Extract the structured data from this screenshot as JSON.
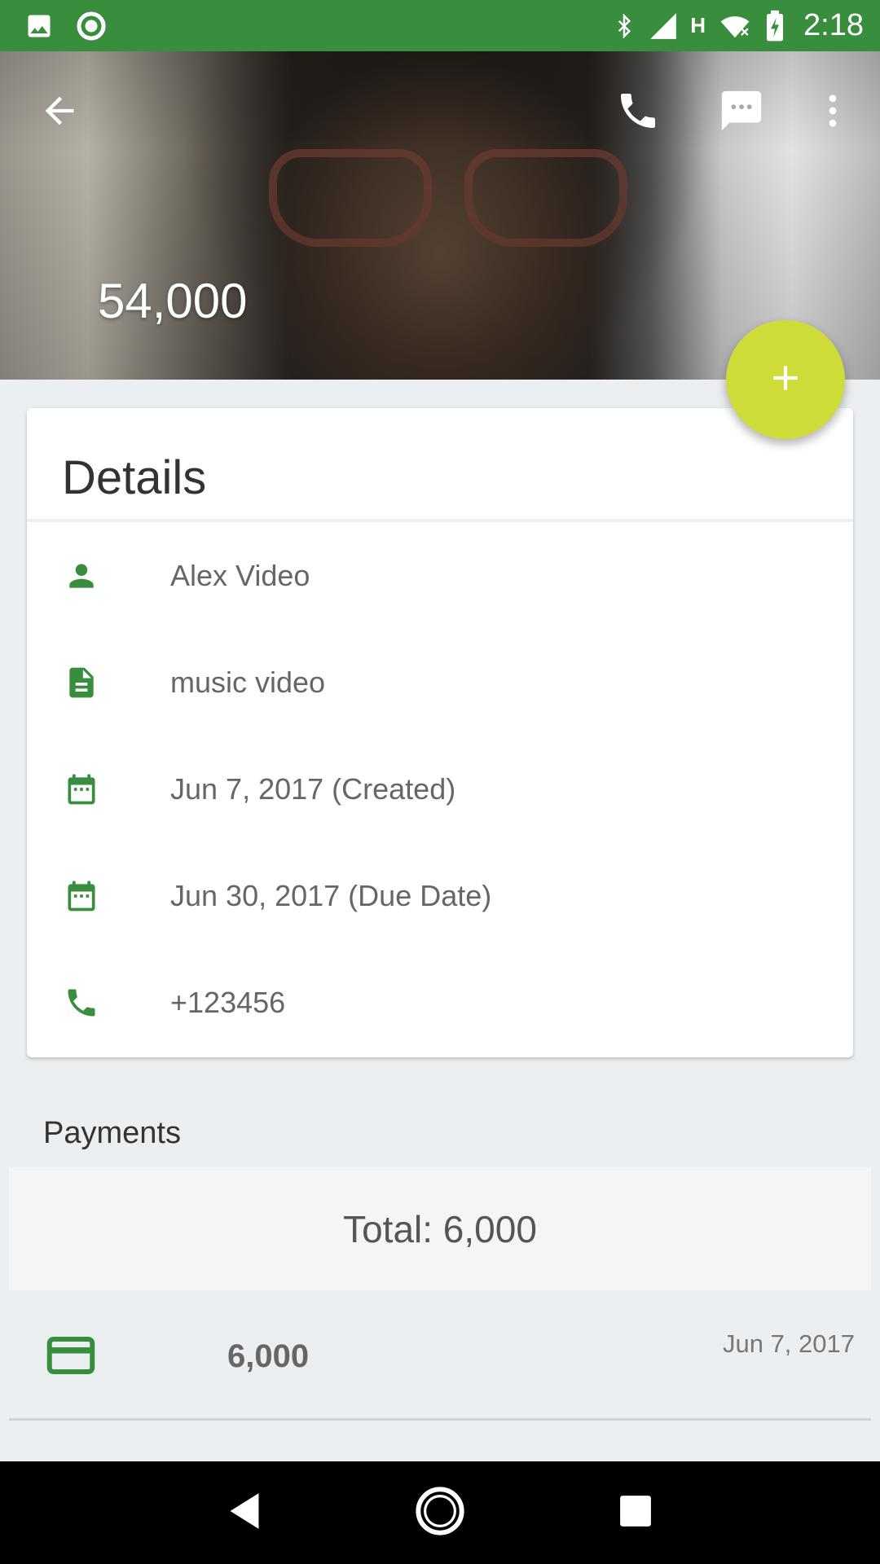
{
  "status_bar": {
    "time": "2:18",
    "network_label": "H",
    "bg_color": "#388e3c",
    "icons_left": [
      "image-icon",
      "circle-notification-icon"
    ],
    "icons_right": [
      "bluetooth-icon",
      "signal-icon",
      "wifi-icon",
      "battery-charging-icon"
    ]
  },
  "header": {
    "amount": "54,000",
    "actions": [
      "back-arrow-icon",
      "phone-icon",
      "message-icon",
      "more-vert-icon"
    ]
  },
  "fab": {
    "icon": "add-icon",
    "color": "#cddc39"
  },
  "details": {
    "title": "Details",
    "rows": [
      {
        "icon": "person-icon",
        "text": "Alex Video"
      },
      {
        "icon": "document-icon",
        "text": "music video"
      },
      {
        "icon": "calendar-icon",
        "text": "Jun 7, 2017 (Created)"
      },
      {
        "icon": "calendar-icon",
        "text": "Jun 30, 2017 (Due Date)"
      },
      {
        "icon": "phone-icon",
        "text": "+123456"
      }
    ],
    "icon_color": "#388e3c"
  },
  "payments": {
    "title": "Payments",
    "total": "Total: 6,000",
    "items": [
      {
        "icon": "credit-card-icon",
        "amount": "6,000",
        "date": "Jun 7, 2017"
      }
    ]
  },
  "nav_bar": {
    "buttons": [
      "back-triangle-icon",
      "home-circle-icon",
      "recents-square-icon"
    ]
  }
}
